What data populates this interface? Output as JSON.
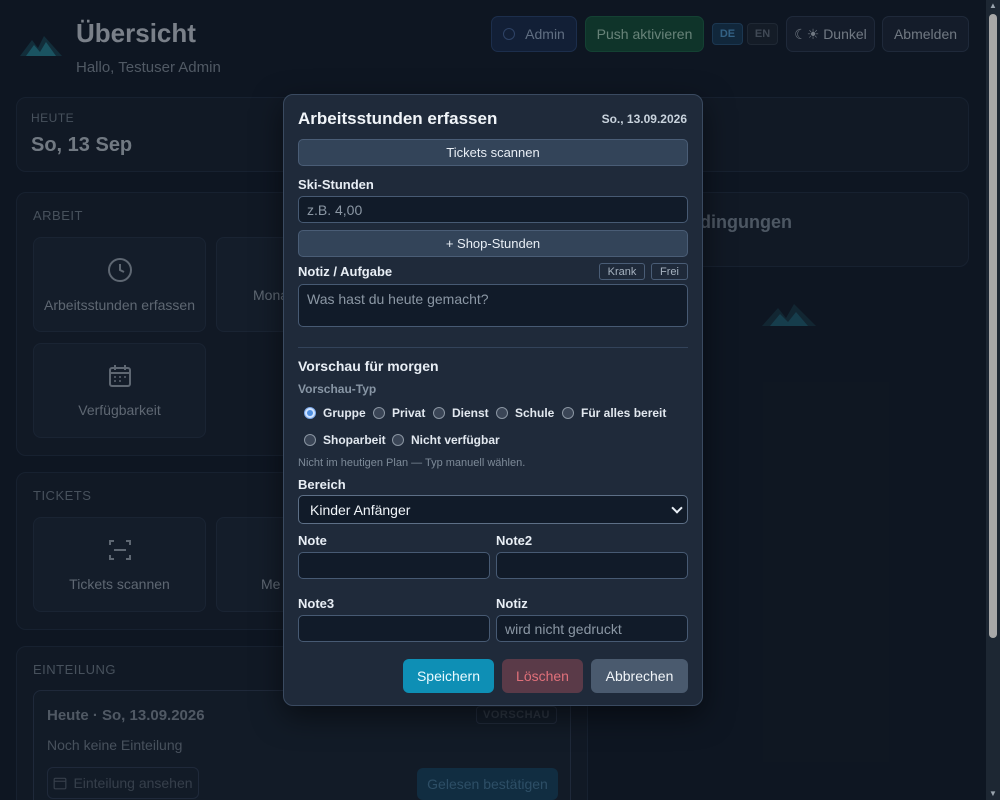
{
  "header": {
    "title": "Übersicht",
    "greeting": "Hallo, Testuser Admin",
    "admin_label": "Admin",
    "push_label": "Push aktivieren",
    "lang_de": "DE",
    "lang_en": "EN",
    "theme_label": "☾☀ Dunkel",
    "logout_label": "Abmelden"
  },
  "today": {
    "label": "HEUTE",
    "date": "So, 13 Sep"
  },
  "arbeit": {
    "label": "ARBEIT",
    "tiles": [
      {
        "label": "Arbeitsstunden erfassen",
        "icon": "clock-icon"
      },
      {
        "label": "Mona",
        "icon": "calendar-icon"
      },
      {
        "label": "Verfügbarkeit",
        "icon": "calendar-icon"
      }
    ]
  },
  "right_card": {
    "text": "dingungen"
  },
  "tickets": {
    "label": "TICKETS",
    "tiles": [
      {
        "label": "Tickets scannen",
        "icon": "scan-icon"
      },
      {
        "label": "Me",
        "icon": "scan-icon"
      }
    ]
  },
  "einteilung": {
    "label": "EINTEILUNG",
    "card_title": "Heute · So, 13.09.2026",
    "badge": "VORSCHAU",
    "empty": "Noch keine Einteilung",
    "view_button": "Einteilung ansehen",
    "confirm_button": "Gelesen bestätigen"
  },
  "modal": {
    "title": "Arbeitsstunden erfassen",
    "date": "So., 13.09.2026",
    "scan_button": "Tickets scannen",
    "ski_label": "Ski-Stunden",
    "ski_placeholder": "z.B. 4,00",
    "shop_button": "+ Shop-Stunden",
    "notiz_label": "Notiz / Aufgabe",
    "chip_krank": "Krank",
    "chip_frei": "Frei",
    "notiz_placeholder": "Was hast du heute gemacht?",
    "preview_title": "Vorschau für morgen",
    "preview_type_label": "Vorschau-Typ",
    "radios": [
      "Gruppe",
      "Privat",
      "Dienst",
      "Schule",
      "Für alles bereit",
      "Shoparbeit",
      "Nicht verfügbar"
    ],
    "selected_radio": "Gruppe",
    "hint": "Nicht im heutigen Plan — Typ manuell wählen.",
    "bereich_label": "Bereich",
    "bereich_value": "Kinder Anfänger",
    "note_label": "Note",
    "note2_label": "Note2",
    "note3_label": "Note3",
    "notiz2_label": "Notiz",
    "notiz2_placeholder": "wird nicht gedruckt",
    "save_button": "Speichern",
    "delete_button": "Löschen",
    "cancel_button": "Abbrechen"
  },
  "colors": {
    "accent": "#0e8fb5",
    "background": "#15202e",
    "modal": "#1f2a3a",
    "danger": "#e0707a"
  }
}
